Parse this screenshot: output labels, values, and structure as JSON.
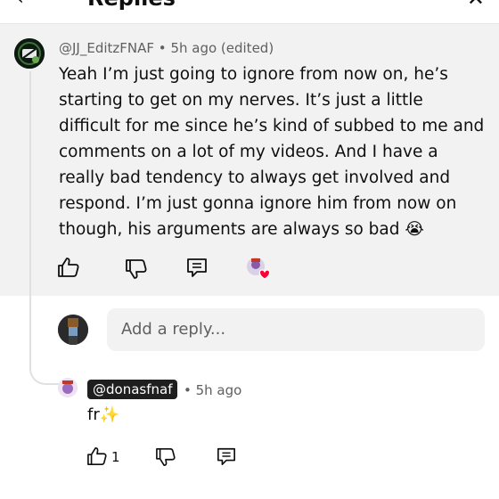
{
  "header": {
    "title": "Replies",
    "back_icon": "back-arrow-icon",
    "close_icon": "close-icon"
  },
  "comment": {
    "author": "@JJ_EditzFNAF",
    "separator": "•",
    "time": "5h ago (edited)",
    "text": "Yeah I’m just going to ignore from now on, he’s starting to get on my nerves. It’s just a little difficult for me since he’s kind of subbed to me and comments on a lot of my videos. And I have a really bad tendency to always get involved and respond. I’m just gonna ignore him from now on though, his arguments are always so bad 😭",
    "actions": [
      "thumbs-up-icon",
      "thumbs-down-icon",
      "reply-icon",
      "creator-heart-icon"
    ]
  },
  "reply_box": {
    "placeholder": "Add a reply..."
  },
  "reply": {
    "author": "@donasfnaf",
    "time": "• 5h ago",
    "text": "fr✨",
    "like_count": "1",
    "actions": [
      "thumbs-up-icon",
      "thumbs-down-icon",
      "reply-icon"
    ]
  },
  "colors": {
    "highlight_bg": "#f2f2f2",
    "secondary_text": "#606060",
    "heart": "#ff0033"
  }
}
